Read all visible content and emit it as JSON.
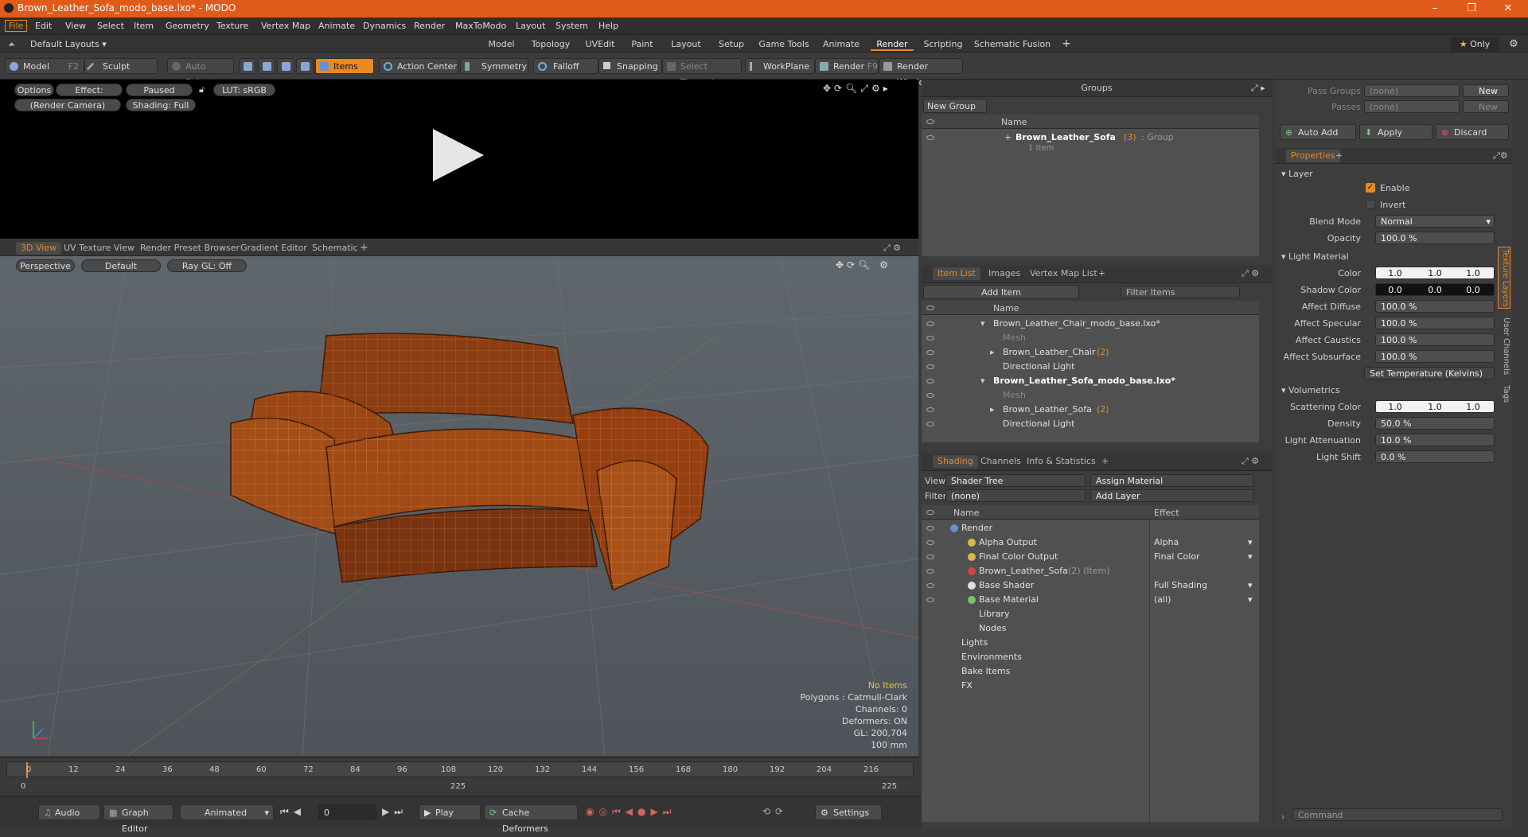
{
  "window": {
    "title": "Brown_Leather_Sofa_modo_base.lxo* - MODO"
  },
  "menu": [
    "File",
    "Edit",
    "View",
    "Select",
    "Item",
    "Geometry",
    "Texture",
    "Vertex Map",
    "Animate",
    "Dynamics",
    "Render",
    "MaxToModo",
    "Layout",
    "System",
    "Help"
  ],
  "layout": {
    "preset": "Default Layouts ▾",
    "tabs": [
      "Model",
      "Topology",
      "UVEdit",
      "Paint",
      "Layout",
      "Setup",
      "Game Tools",
      "Animate",
      "Render",
      "Scripting",
      "Schematic Fusion"
    ],
    "active": "Render",
    "only": "Only"
  },
  "toolbar": {
    "model": "Model",
    "model_key": "F2",
    "sculpt": "Sculpt",
    "auto_select": "Auto Select",
    "items": "Items",
    "action_center": "Action Center",
    "symmetry": "Symmetry",
    "falloff": "Falloff",
    "snapping": "Snapping",
    "select_through": "Select Through",
    "workplane": "WorkPlane",
    "render": "Render",
    "render_key": "F9",
    "render_window": "Render Window"
  },
  "render_view": {
    "options": "Options",
    "effect": "Effect: (Shadi...",
    "paused": "Paused",
    "lut": "LUT: sRGB",
    "camera": "(Render Camera)",
    "shading": "Shading: Full"
  },
  "viewport_tabs": [
    "3D View",
    "UV Texture View",
    "Render Preset Browser",
    "Gradient Editor",
    "Schematic"
  ],
  "viewport": {
    "perspective": "Perspective",
    "default": "Default",
    "raygl": "Ray GL: Off",
    "no_items": "No Items",
    "stats": [
      "Polygons : Catmull-Clark",
      "Channels: 0",
      "Deformers: ON",
      "GL: 200,704",
      "100 mm"
    ]
  },
  "timeline": {
    "ticks": [
      "0",
      "12",
      "24",
      "36",
      "48",
      "60",
      "72",
      "84",
      "96",
      "108",
      "120",
      "132",
      "144",
      "156",
      "168",
      "180",
      "192",
      "204",
      "216"
    ],
    "sub_ticks": [
      "0",
      "225",
      "225"
    ]
  },
  "bottom": {
    "audio": "Audio",
    "graph_editor": "Graph Editor",
    "animated": "Animated",
    "frame": "0",
    "play": "Play",
    "cache": "Cache Deformers",
    "settings": "Settings"
  },
  "groups": {
    "title": "Groups",
    "new_group": "New Group",
    "col_name": "Name",
    "item_name": "Brown_Leather_Sofa",
    "item_count": "(3)",
    "item_type": ": Group",
    "item_sub": "1 Item"
  },
  "item_list": {
    "tabs": [
      "Item List",
      "Images",
      "Vertex Map List"
    ],
    "add_item": "Add Item",
    "filter": "Filter Items",
    "col_name": "Name",
    "rows": [
      {
        "name": "Brown_Leather_Chair_modo_base.lxo*",
        "indent": 0,
        "bold": false,
        "dim": false,
        "suffix": ""
      },
      {
        "name": "Mesh",
        "indent": 2,
        "bold": false,
        "dim": true,
        "suffix": ""
      },
      {
        "name": "Brown_Leather_Chair",
        "indent": 2,
        "bold": false,
        "dim": false,
        "suffix": "(2)"
      },
      {
        "name": "Directional Light",
        "indent": 2,
        "bold": false,
        "dim": false,
        "suffix": ""
      },
      {
        "name": "Brown_Leather_Sofa_modo_base.lxo*",
        "indent": 0,
        "bold": true,
        "dim": false,
        "suffix": ""
      },
      {
        "name": "Mesh",
        "indent": 2,
        "bold": false,
        "dim": true,
        "suffix": ""
      },
      {
        "name": "Brown_Leather_Sofa",
        "indent": 2,
        "bold": false,
        "dim": false,
        "suffix": "(2)"
      },
      {
        "name": "Directional Light",
        "indent": 2,
        "bold": false,
        "dim": false,
        "suffix": ""
      }
    ]
  },
  "shading": {
    "tabs": [
      "Shading",
      "Channels",
      "Info & Statistics"
    ],
    "view_label": "View",
    "view_value": "Shader Tree",
    "assign": "Assign Material",
    "filter_label": "Filter",
    "filter_value": "(none)",
    "add_layer": "Add Layer",
    "col_name": "Name",
    "col_effect": "Effect",
    "rows": [
      {
        "name": "Render",
        "effect": "",
        "indent": 0
      },
      {
        "name": "Alpha Output",
        "effect": "Alpha",
        "indent": 1
      },
      {
        "name": "Final Color Output",
        "effect": "Final Color",
        "indent": 1
      },
      {
        "name": "Brown_Leather_Sofa",
        "effect": "",
        "indent": 1,
        "suffix": "(2) (Item)"
      },
      {
        "name": "Base Shader",
        "effect": "Full Shading",
        "indent": 1
      },
      {
        "name": "Base Material",
        "effect": "(all)",
        "indent": 1
      },
      {
        "name": "Library",
        "effect": "",
        "indent": 1
      },
      {
        "name": "Nodes",
        "effect": "",
        "indent": 1
      },
      {
        "name": "Lights",
        "effect": "",
        "indent": 0
      },
      {
        "name": "Environments",
        "effect": "",
        "indent": 0
      },
      {
        "name": "Bake Items",
        "effect": "",
        "indent": 0
      },
      {
        "name": "FX",
        "effect": "",
        "indent": 0
      }
    ]
  },
  "props": {
    "pass_groups": "Pass Groups",
    "passes": "Passes",
    "none": "(none)",
    "new": "New",
    "auto_add": "Auto Add",
    "apply": "Apply",
    "discard": "Discard",
    "tab": "Properties",
    "layer": "Layer",
    "enable": "Enable",
    "invert": "Invert",
    "blend_mode": "Blend Mode",
    "blend_value": "Normal",
    "opacity": "Opacity",
    "opacity_value": "100.0 %",
    "light_material": "Light Material",
    "color": "Color",
    "color_vals": [
      "1.0",
      "1.0",
      "1.0"
    ],
    "shadow_color": "Shadow Color",
    "shadow_vals": [
      "0.0",
      "0.0",
      "0.0"
    ],
    "affect_diffuse": "Affect Diffuse",
    "affect_specular": "Affect Specular",
    "affect_caustics": "Affect Caustics",
    "affect_subsurface": "Affect Subsurface",
    "pct": "100.0 %",
    "set_temp": "Set Temperature (Kelvins)",
    "volumetrics": "Volumetrics",
    "scattering": "Scattering Color",
    "scatter_vals": [
      "1.0",
      "1.0",
      "1.0"
    ],
    "density": "Density",
    "density_value": "50.0 %",
    "attenuation": "Light Attenuation",
    "attenuation_value": "10.0 %",
    "light_shift": "Light Shift",
    "light_shift_value": "0.0 %",
    "side_tabs": [
      "Texture Layers",
      "User Channels",
      "Tags"
    ],
    "command": "Command"
  }
}
